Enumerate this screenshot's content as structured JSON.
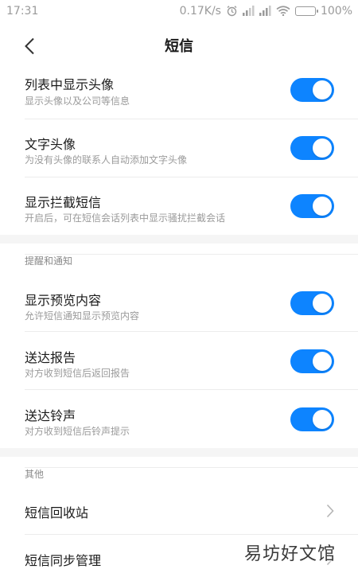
{
  "status_bar": {
    "time": "17:31",
    "network_speed": "0.17K/s",
    "battery": "100%",
    "icons": [
      "alarm-icon",
      "signal-icon",
      "signal-icon",
      "wifi-icon",
      "battery-icon"
    ]
  },
  "nav": {
    "title": "短信",
    "back_icon": "back-chevron-icon"
  },
  "settings": [
    {
      "title": "列表中显示头像",
      "subtitle": "显示头像以及公司等信息",
      "enabled": true
    },
    {
      "title": "文字头像",
      "subtitle": "为没有头像的联系人自动添加文字头像",
      "enabled": true
    },
    {
      "title": "显示拦截短信",
      "subtitle": "开启后，可在短信会话列表中显示骚扰拦截会话",
      "enabled": true
    }
  ],
  "notify_section": {
    "header": "提醒和通知",
    "items": [
      {
        "title": "显示预览内容",
        "subtitle": "允许短信通知显示预览内容",
        "enabled": true
      },
      {
        "title": "送达报告",
        "subtitle": "对方收到短信后返回报告",
        "enabled": true
      },
      {
        "title": "送达铃声",
        "subtitle": "对方收到短信后铃声提示",
        "enabled": true
      }
    ]
  },
  "other_section": {
    "header": "其他",
    "items": [
      {
        "title": "短信回收站"
      },
      {
        "title": "短信同步管理"
      }
    ]
  },
  "watermark": "易坊好文馆",
  "colors": {
    "accent": "#0d84ff",
    "section_bg": "#f5f5f5",
    "secondary_text": "#9a9a9a"
  }
}
